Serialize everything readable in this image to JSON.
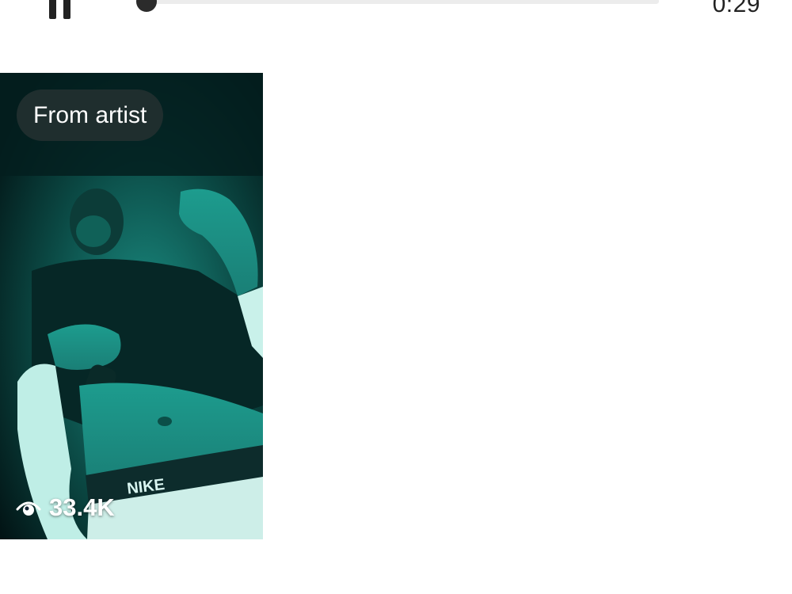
{
  "player": {
    "time": "0:29",
    "progress": 0.0
  },
  "video": {
    "badge": "From artist",
    "views": "33.4K",
    "waistband_text": "NIKE"
  },
  "icons": {
    "pause": "pause-icon",
    "views": "eye-icon"
  },
  "colors": {
    "thumbnail_tint": "#1fb5a3",
    "badge_bg": "#22303a"
  }
}
